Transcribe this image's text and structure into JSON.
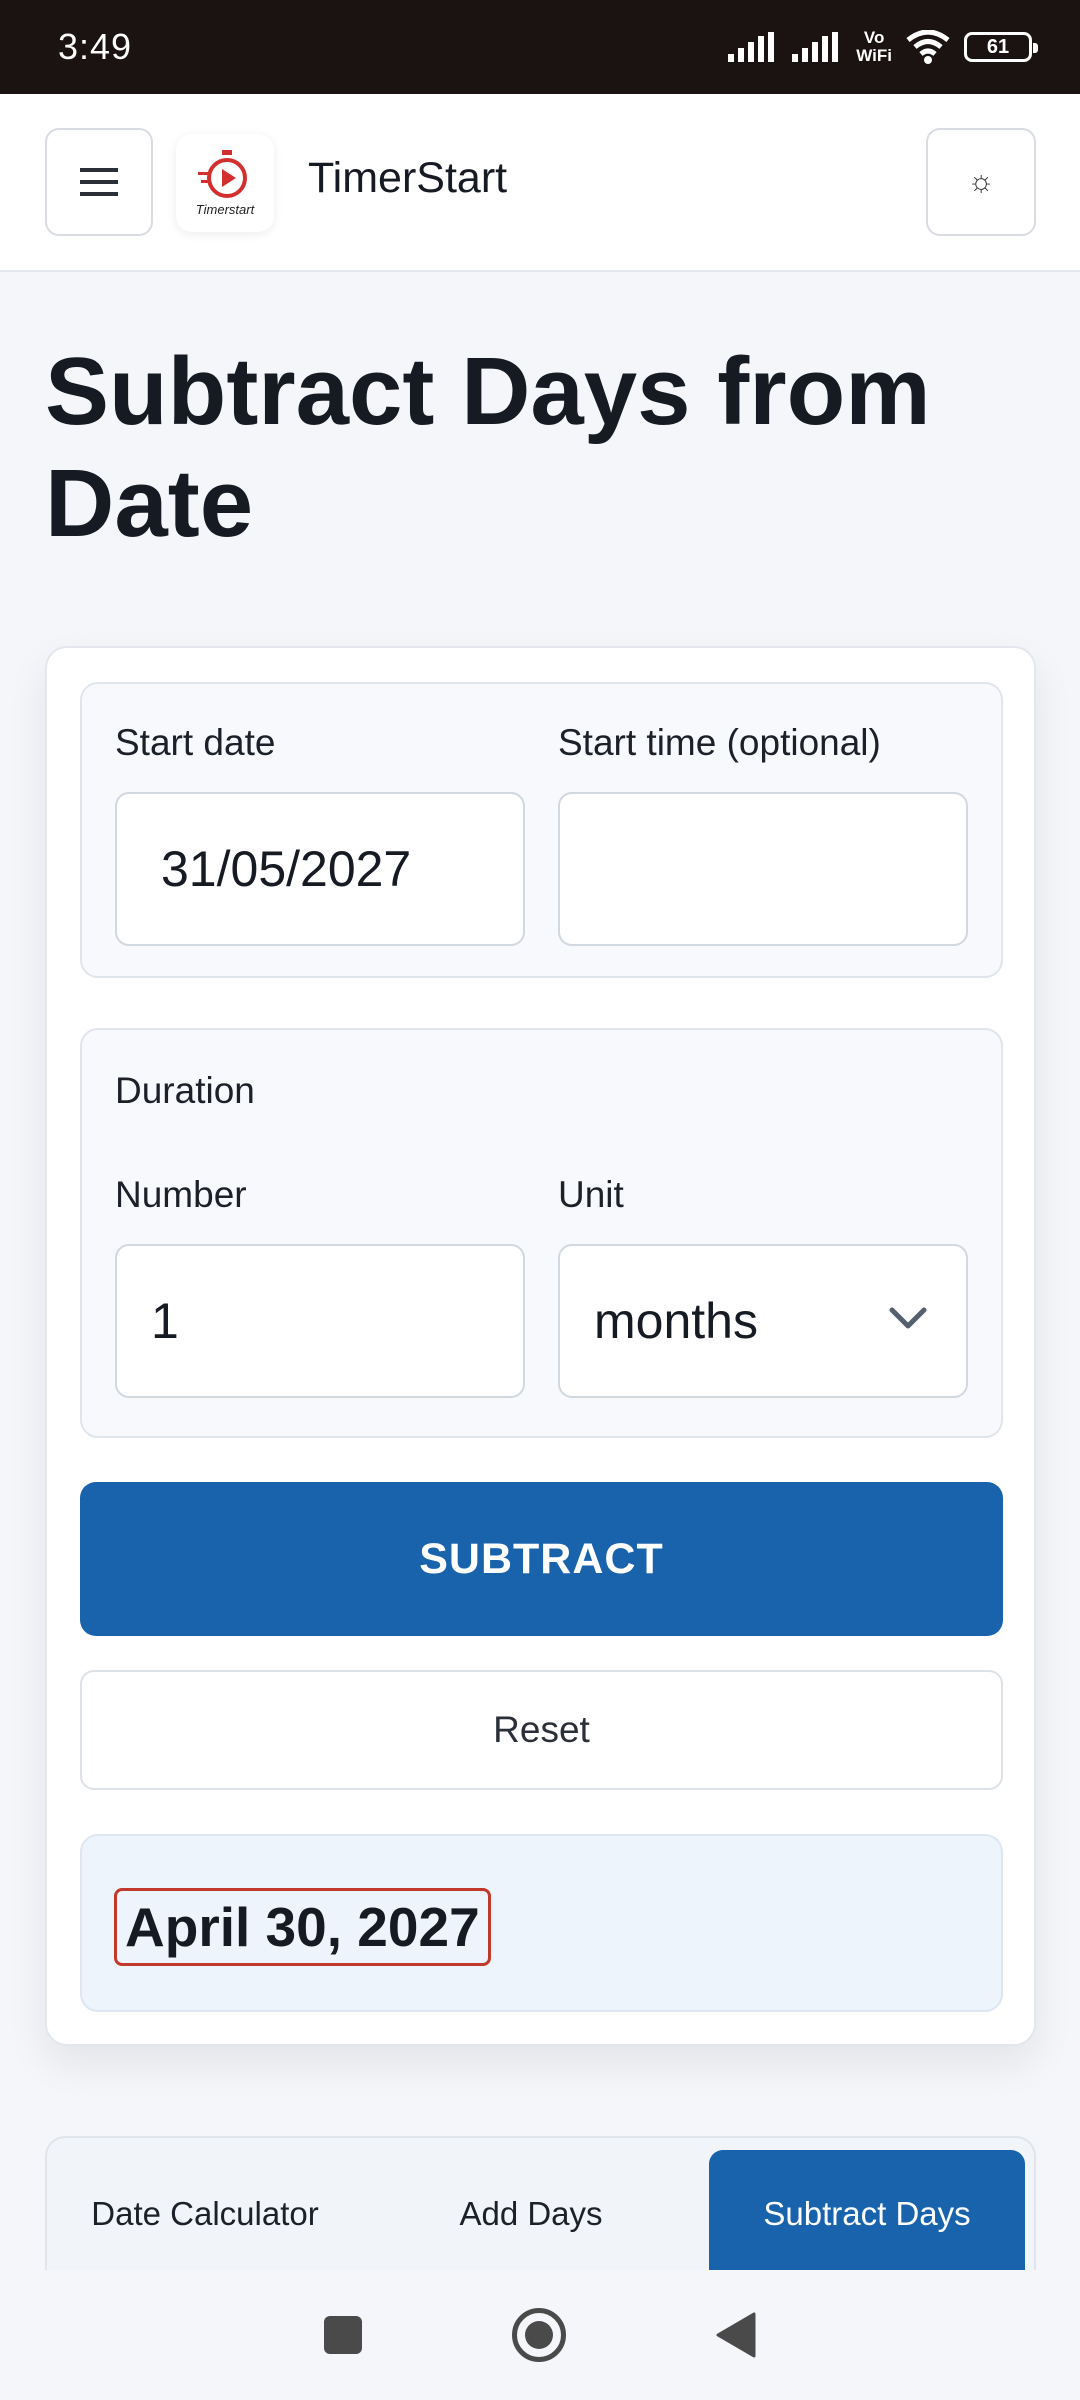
{
  "status_bar": {
    "time": "3:49",
    "network_label_top": "Vo",
    "network_label_bottom": "WiFi",
    "battery_level": "61",
    "icons": [
      "signal-icon",
      "signal-icon",
      "vowifi-icon",
      "wifi-icon",
      "battery-icon"
    ]
  },
  "header": {
    "brand": "TimerStart",
    "logo_text": "Timerstart",
    "menu_icon": "hamburger-icon",
    "theme_icon": "sun-icon",
    "theme_glyph": "☼"
  },
  "page": {
    "title": "Subtract Days from Date"
  },
  "form": {
    "start_date_label": "Start date",
    "start_date_value": "31/05/2027",
    "start_time_label": "Start time (optional)",
    "start_time_value": "",
    "duration_heading": "Duration",
    "number_label": "Number",
    "number_value": "1",
    "unit_label": "Unit",
    "unit_value": "months",
    "subtract_label": "SUBTRACT",
    "reset_label": "Reset"
  },
  "result": {
    "value": "April 30, 2027"
  },
  "tabs": [
    {
      "label": "Date Calculator",
      "active": false
    },
    {
      "label": "Add Days",
      "active": false
    },
    {
      "label": "Subtract Days",
      "active": true
    }
  ],
  "colors": {
    "primary": "#1963ad",
    "status_bar": "#1b1212",
    "result_bg": "#eef4fc",
    "result_outline": "#c0392b"
  }
}
